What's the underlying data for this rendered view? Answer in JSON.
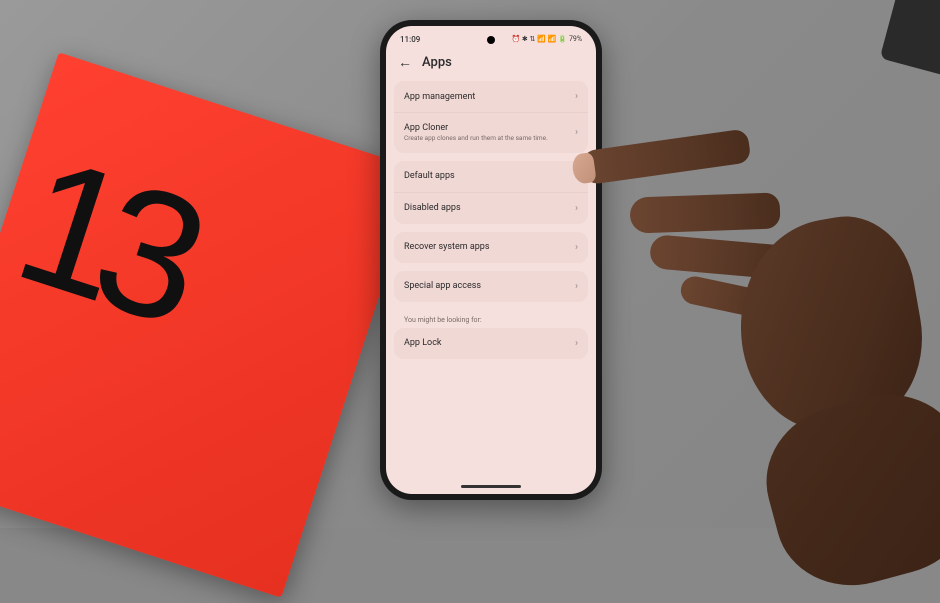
{
  "status": {
    "time": "11:09",
    "icons": "⏰ ✱ ⇅ 📶 📶",
    "battery": "79%"
  },
  "header": {
    "title": "Apps"
  },
  "groups": [
    {
      "items": [
        {
          "title": "App management",
          "sub": ""
        },
        {
          "title": "App Cloner",
          "sub": "Create app clones and run them at the same time."
        }
      ]
    },
    {
      "items": [
        {
          "title": "Default apps",
          "sub": ""
        },
        {
          "title": "Disabled apps",
          "sub": ""
        }
      ]
    },
    {
      "items": [
        {
          "title": "Recover system apps",
          "sub": ""
        }
      ]
    },
    {
      "items": [
        {
          "title": "Special app access",
          "sub": ""
        }
      ]
    }
  ],
  "suggest": {
    "label": "You might be looking for:",
    "item": "App Lock"
  }
}
